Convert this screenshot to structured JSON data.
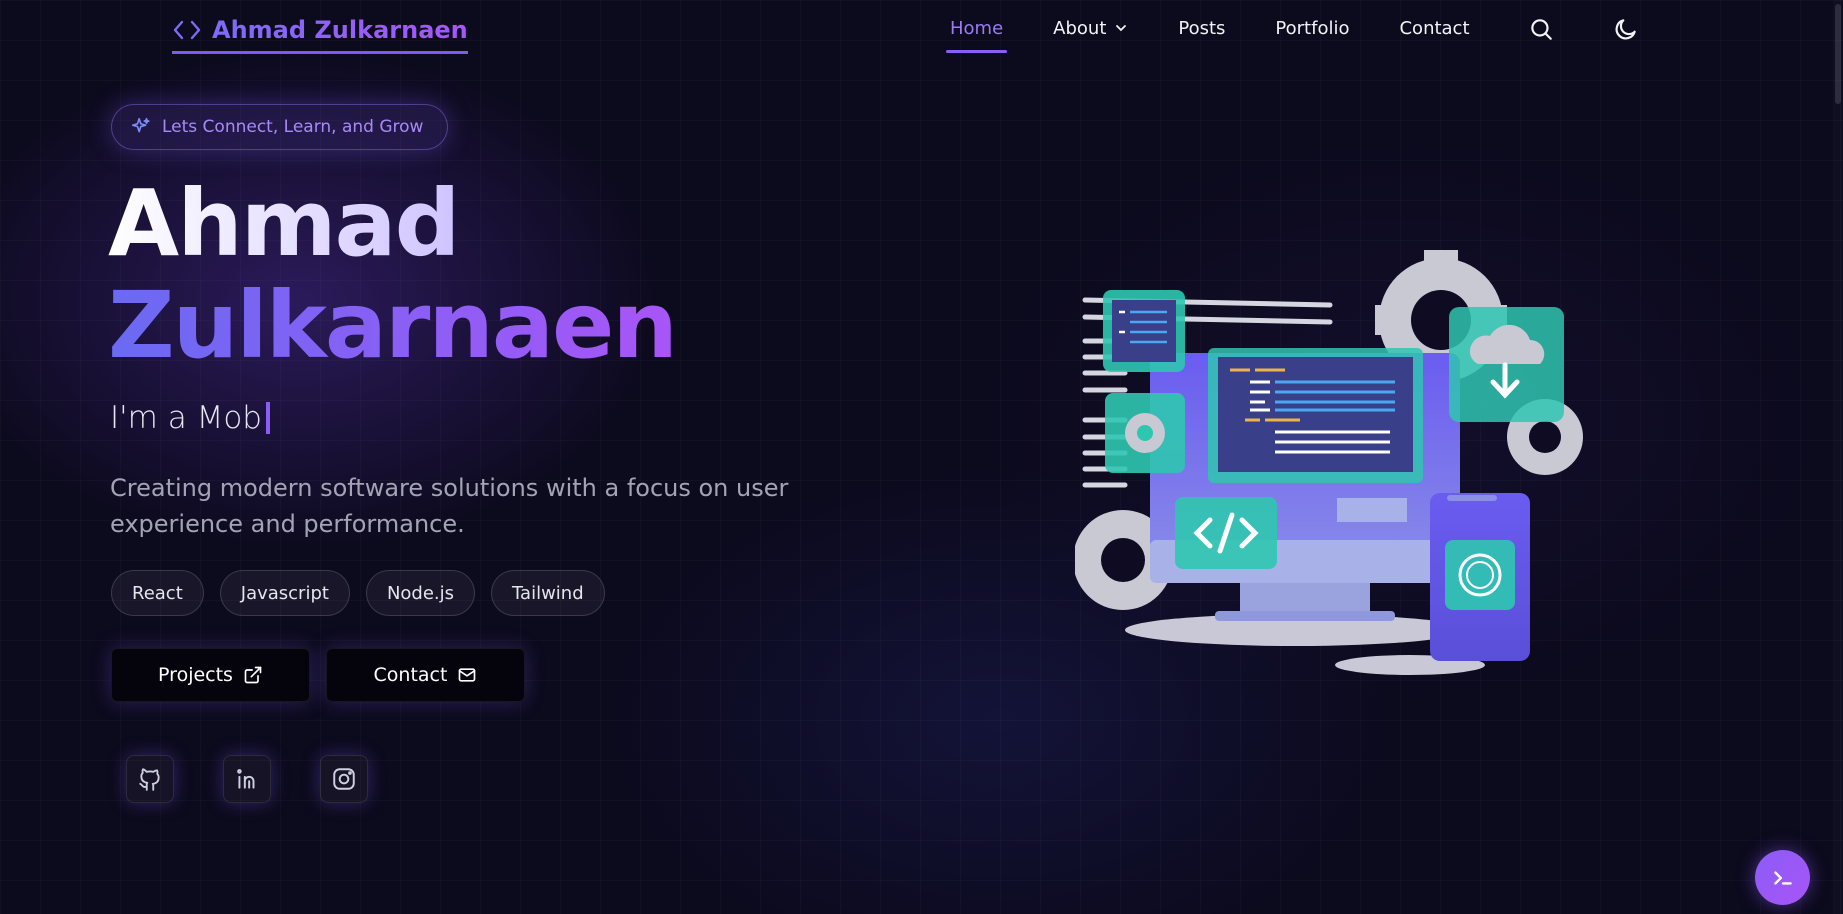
{
  "brand": {
    "name": "Ahmad Zulkarnaen",
    "icon": "code-brackets-icon",
    "color": "#7c5cf0"
  },
  "nav": {
    "items": [
      {
        "label": "Home",
        "active": true
      },
      {
        "label": "About",
        "has_dropdown": true
      },
      {
        "label": "Posts"
      },
      {
        "label": "Portfolio"
      },
      {
        "label": "Contact"
      }
    ],
    "icons": [
      "search-icon",
      "moon-icon"
    ]
  },
  "hero": {
    "pill_text": "Lets Connect, Learn, and Grow",
    "pill_icon": "sparkles-icon",
    "title_first": "Ahmad",
    "title_last": "Zulkarnaen",
    "typed_text": "I'm a Mob",
    "description": "Creating modern software solutions with a focus on user experience and performance.",
    "tags": [
      "React",
      "Javascript",
      "Node.js",
      "Tailwind"
    ],
    "buttons": [
      {
        "label": "Projects",
        "icon": "external-link-icon"
      },
      {
        "label": "Contact",
        "icon": "mail-icon"
      }
    ],
    "socials": [
      "github-icon",
      "linkedin-icon",
      "instagram-icon"
    ],
    "illustration": "developer-illustration"
  },
  "fab": {
    "icon": "terminal-icon"
  },
  "colors": {
    "accent": "#8b5cf6",
    "accent_blue": "#6a6af2",
    "background": "#0c0a1d"
  }
}
